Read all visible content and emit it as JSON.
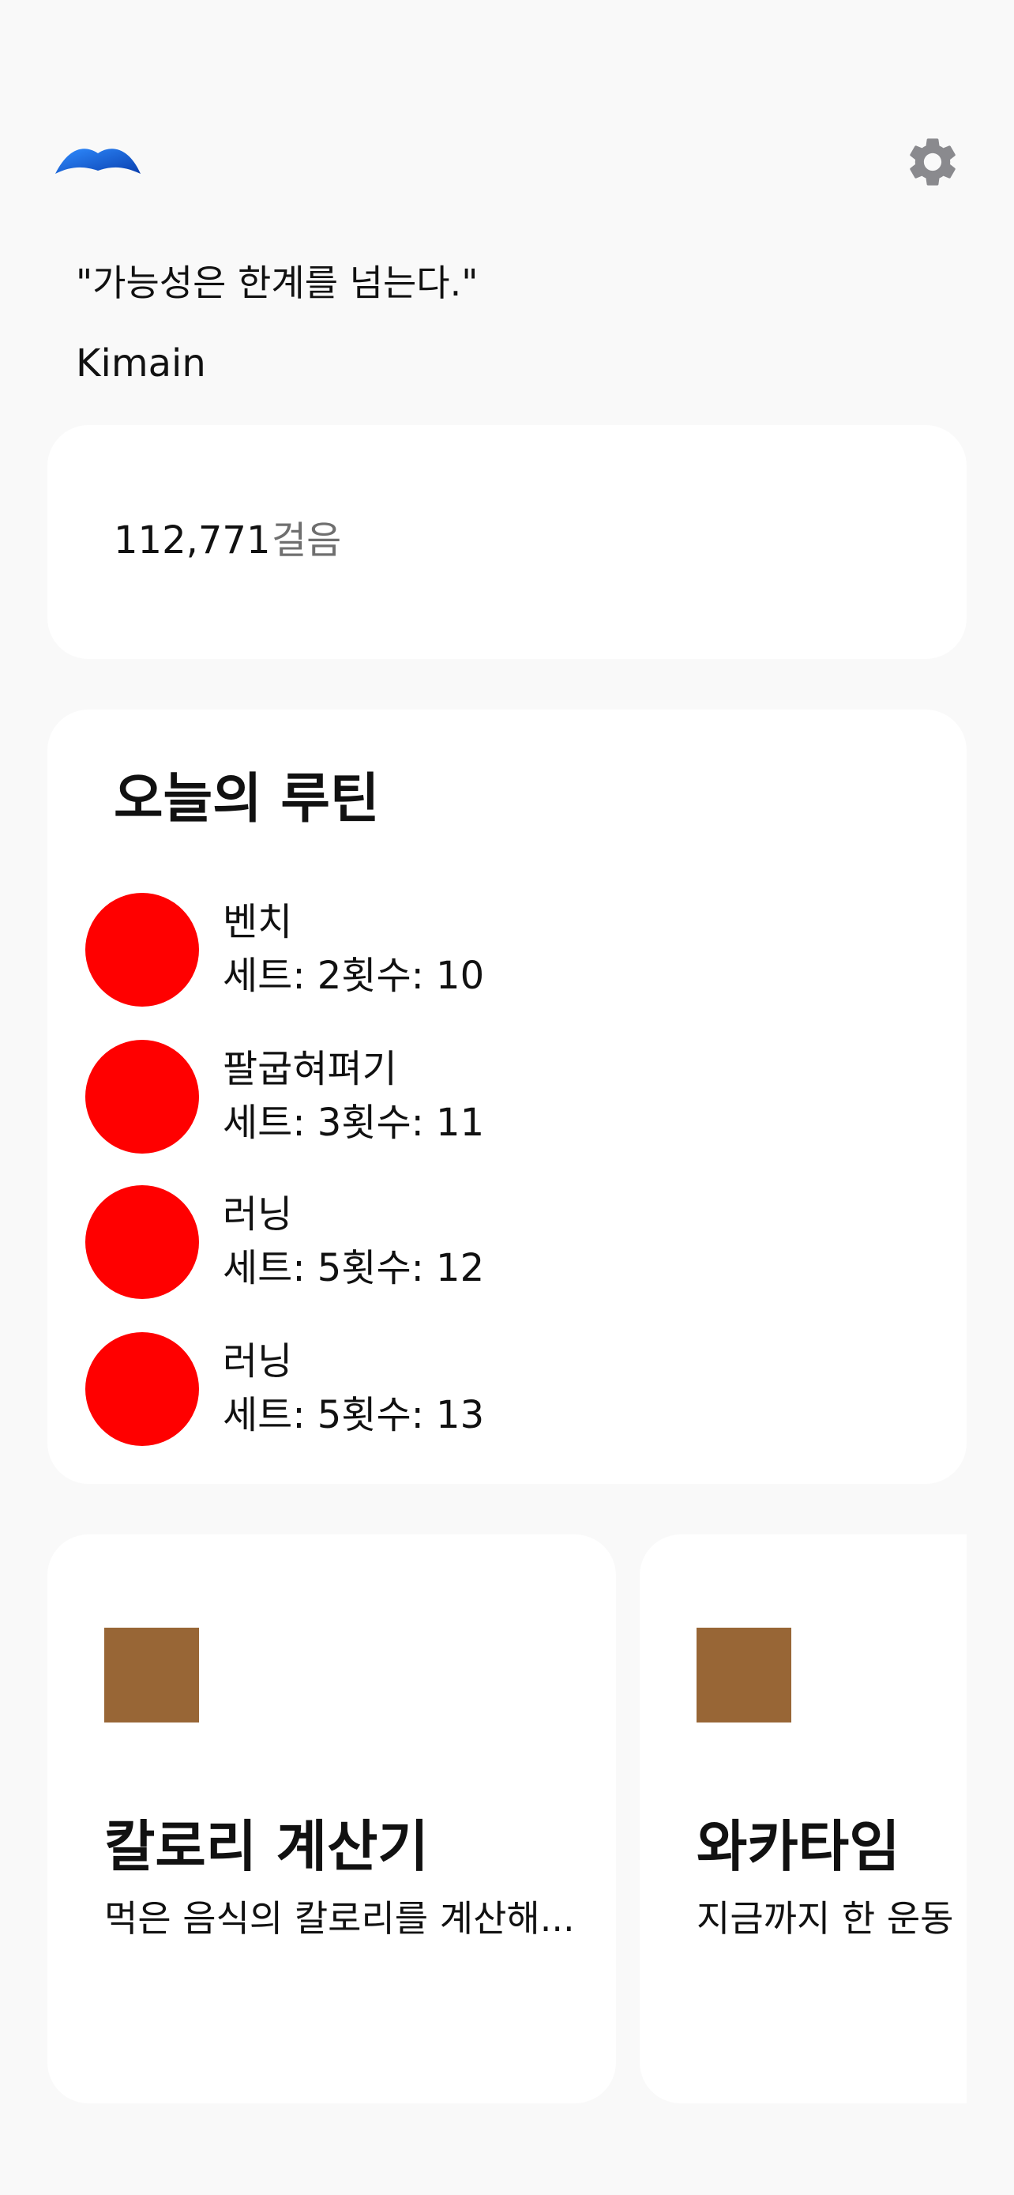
{
  "header": {
    "logo_icon": "wave-logo-icon",
    "settings_icon": "gear-icon"
  },
  "quote": {
    "text": "\"가능성은 한계를 넘는다.\"",
    "author": "Kimain"
  },
  "steps": {
    "value": "112,771",
    "unit": "걸음"
  },
  "routine": {
    "title": "오늘의 루틴",
    "dot_color": "#ff0000",
    "items": [
      {
        "name": "벤치",
        "detail": "세트: 2횟수: 10"
      },
      {
        "name": "팔굽혀펴기",
        "detail": "세트: 3횟수: 11"
      },
      {
        "name": "러닝",
        "detail": "세트: 5횟수: 12"
      },
      {
        "name": "러닝",
        "detail": "세트: 5횟수: 13"
      }
    ]
  },
  "features": [
    {
      "title": "칼로리 계산기",
      "description": "먹은 음식의 칼로리를 계산해...",
      "icon_color": "#986636"
    },
    {
      "title": "와카타임",
      "description": "지금까지 한 운동",
      "icon_color": "#986636"
    }
  ],
  "colors": {
    "background": "#f9f9f9",
    "card": "#ffffff",
    "logo_blue": "#1565e0",
    "settings_gray": "#8a8a8e"
  }
}
